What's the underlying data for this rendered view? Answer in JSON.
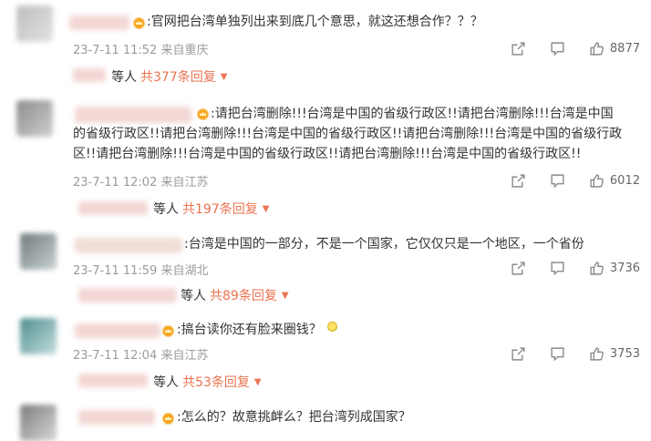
{
  "comments": [
    {
      "lines": [
        ":官网把台湾单独列出来到底几个意思，就这还想合作？？？"
      ],
      "time": "23-7-11 11:52",
      "location": "来自重庆",
      "likes": "8877",
      "reply_who": "等人",
      "reply_count": "共377条回复"
    },
    {
      "lines": [
        ":请把台湾删除!!!台湾是中国的省级行政区!!请把台湾删除!!!台湾是中国",
        "的省级行政区!!请把台湾删除!!!台湾是中国的省级行政区!!请把台湾删除!!!台湾是中国的省级行政",
        "区!!请把台湾删除!!!台湾是中国的省级行政区!!请把台湾删除!!!台湾是中国的省级行政区!!"
      ],
      "time": "23-7-11 12:02",
      "location": "来自江苏",
      "likes": "6012",
      "reply_who": "等人",
      "reply_count": "共197条回复"
    },
    {
      "lines": [
        ":台湾是中国的一部分，不是一个国家，它仅仅只是一个地区，一个省份"
      ],
      "time": "23-7-11 11:59",
      "location": "来自湖北",
      "likes": "3736",
      "reply_who": "等人",
      "reply_count": "共89条回复"
    },
    {
      "lines": [
        ":搞台读你还有脸来圈钱？"
      ],
      "time": "23-7-11 12:04",
      "location": "来自江苏",
      "likes": "3753",
      "reply_who": "等人",
      "reply_count": "共53条回复"
    },
    {
      "lines": [
        ":怎么的？故意挑衅么？把台湾列成国家？"
      ]
    }
  ],
  "icons": [
    "share-icon",
    "comment-icon",
    "like-icon",
    "caret-down-icon",
    "crown-badge-icon",
    "lightbulb-emoji-icon"
  ],
  "colors": {
    "accent": "#eb7350",
    "meta": "#9a9a9a",
    "text": "#333333"
  }
}
